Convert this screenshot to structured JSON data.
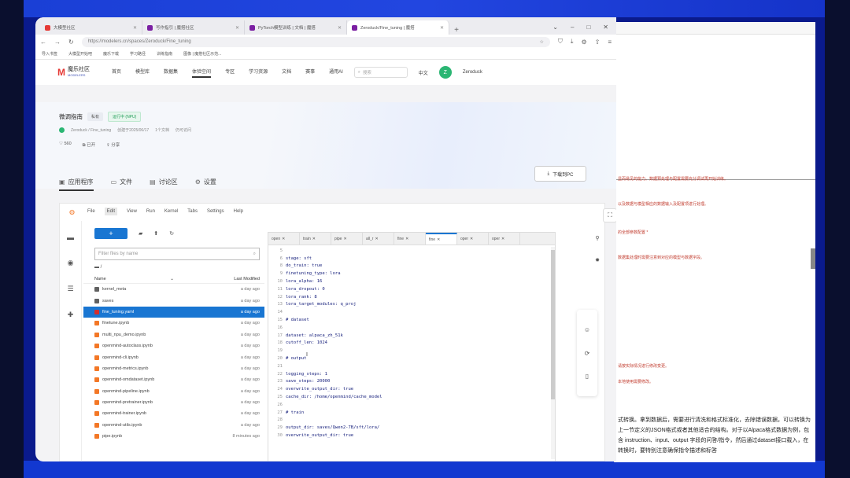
{
  "browser": {
    "tabs": [
      {
        "label": "大模型社区",
        "active": false
      },
      {
        "label": "写作指引 | 魔搭社区",
        "active": false
      },
      {
        "label": "PyTorch模型训练 | 文档 | 魔搭",
        "active": false
      },
      {
        "label": "Zeroduck/Fine_tuning | 魔搭",
        "active": true
      }
    ],
    "new_tab": "+",
    "url": "https://modelers.cn/spaces/Zeroduck/Fine_tuning",
    "bookmarks": [
      "导入书签",
      "大模型开始吧",
      "魔乐下载",
      "学习路径",
      "训练指南",
      "图像 | 魔搭社区示范..."
    ]
  },
  "site": {
    "brand_mark": "M",
    "brand_name": "魔乐社区",
    "brand_sub": "MODELERS",
    "nav": [
      "首页",
      "模型库",
      "数据集",
      "体验空间",
      "专区",
      "学习资源",
      "文档",
      "赛事",
      "通用AI"
    ],
    "search_placeholder": "搜索",
    "lang": "中文",
    "user_initial": "Z",
    "username": "Zeroduck"
  },
  "project": {
    "title": "微调指南",
    "badge_public": "私有",
    "badge_running": "运行中 (NPU)",
    "owner": "Zeroduck / Fine_tuning",
    "meta_created": "创建于2025/06/17",
    "meta_docs": "1个文档",
    "meta_status": "仍可访问",
    "stat_likes": "560",
    "stat_forks": "已开",
    "stat_users": "分享",
    "download_label": "下载到PC",
    "subtabs": [
      "应用程序",
      "文件",
      "讨论区",
      "设置"
    ]
  },
  "jupyter": {
    "menu": [
      "File",
      "Edit",
      "View",
      "Run",
      "Kernel",
      "Tabs",
      "Settings",
      "Help"
    ],
    "filter_placeholder": "Filter files by name",
    "breadcrumb": "/",
    "col_name": "Name",
    "col_modified": "Last Modified",
    "files": [
      {
        "name": "kernel_meta",
        "type": "folder",
        "modified": "a day ago",
        "selected": false
      },
      {
        "name": "saves",
        "type": "folder",
        "modified": "a day ago",
        "selected": false
      },
      {
        "name": "fine_tuning.yaml",
        "type": "yaml",
        "modified": "a day ago",
        "selected": true
      },
      {
        "name": "finetune.ipynb",
        "type": "nb",
        "modified": "a day ago",
        "selected": false
      },
      {
        "name": "multi_npu_demo.ipynb",
        "type": "nb",
        "modified": "a day ago",
        "selected": false
      },
      {
        "name": "openmind-autoclass.ipynb",
        "type": "nb",
        "modified": "a day ago",
        "selected": false
      },
      {
        "name": "openmind-cli.ipynb",
        "type": "nb",
        "modified": "a day ago",
        "selected": false
      },
      {
        "name": "openmind-metrics.ipynb",
        "type": "nb",
        "modified": "a day ago",
        "selected": false
      },
      {
        "name": "openmind-omdataset.ipynb",
        "type": "nb",
        "modified": "a day ago",
        "selected": false
      },
      {
        "name": "openmind-pipeline.ipynb",
        "type": "nb",
        "modified": "a day ago",
        "selected": false
      },
      {
        "name": "openmind-pretrainer.ipynb",
        "type": "nb",
        "modified": "a day ago",
        "selected": false
      },
      {
        "name": "openmind-trainer.ipynb",
        "type": "nb",
        "modified": "a day ago",
        "selected": false
      },
      {
        "name": "openmind-utils.ipynb",
        "type": "nb",
        "modified": "a day ago",
        "selected": false
      },
      {
        "name": "pipe.ipynb",
        "type": "nb",
        "modified": "8 minutes ago",
        "selected": false
      }
    ],
    "editor_tabs": [
      "open",
      "train",
      "pipe",
      "all_r",
      "fine",
      "fine",
      "oper",
      "oper"
    ],
    "editor_active_index": 5,
    "code_lines": [
      {
        "n": "5",
        "t": ""
      },
      {
        "n": "6",
        "t": "stage: sft"
      },
      {
        "n": "8",
        "t": "do_train: true"
      },
      {
        "n": "9",
        "t": "finetuning_type: lora"
      },
      {
        "n": "10",
        "t": "lora_alpha: 16"
      },
      {
        "n": "11",
        "t": "lora_dropout: 0"
      },
      {
        "n": "12",
        "t": "lora_rank: 8"
      },
      {
        "n": "13",
        "t": "lora_target_modules: q_proj"
      },
      {
        "n": "14",
        "t": ""
      },
      {
        "n": "15",
        "t": "# dataset"
      },
      {
        "n": "16",
        "t": ""
      },
      {
        "n": "17",
        "t": "dataset: alpaca_zh_51k"
      },
      {
        "n": "18",
        "t": "cutoff_len: 1024"
      },
      {
        "n": "19",
        "t": ""
      },
      {
        "n": "20",
        "t": "# output"
      },
      {
        "n": "21",
        "t": ""
      },
      {
        "n": "22",
        "t": "logging_steps: 1"
      },
      {
        "n": "23",
        "t": "save_steps: 20000"
      },
      {
        "n": "24",
        "t": "overwrite_output_dir: true"
      },
      {
        "n": "25",
        "t": "cache_dir: /home/openmind/cache_model"
      },
      {
        "n": "26",
        "t": ""
      },
      {
        "n": "27",
        "t": "# train"
      },
      {
        "n": "28",
        "t": ""
      },
      {
        "n": "29",
        "t": "output_dir: saves/Qwen2-7B/sft/lora/"
      },
      {
        "n": "30",
        "t": "overwrite_output_dir: true"
      }
    ]
  },
  "document": {
    "red_lines": [
      "显而易见的能力。数据预处理与配置需要充分调试再开始训练。",
      "以及数据与模型相应的数据输入及配置项进行处理。",
      "的全部参数配置 *",
      "数据集处理时需要注意到对应的模型与数据字段。",
      "请按实际情况进行修改变更。",
      "本地使用需要修改。"
    ],
    "paragraph": "式转换。拿到数据后，需要进行清洗和格式标准化，去除错误数据，可以转换为上一节定义的JSON格式或者其他适合的结构。对于以Alpaca格式数据为例，包含 instruction、input、output 字段的问答/指令，然后通过dataset接口载入，在转换时，要特别注意确保指令描述和标答"
  }
}
